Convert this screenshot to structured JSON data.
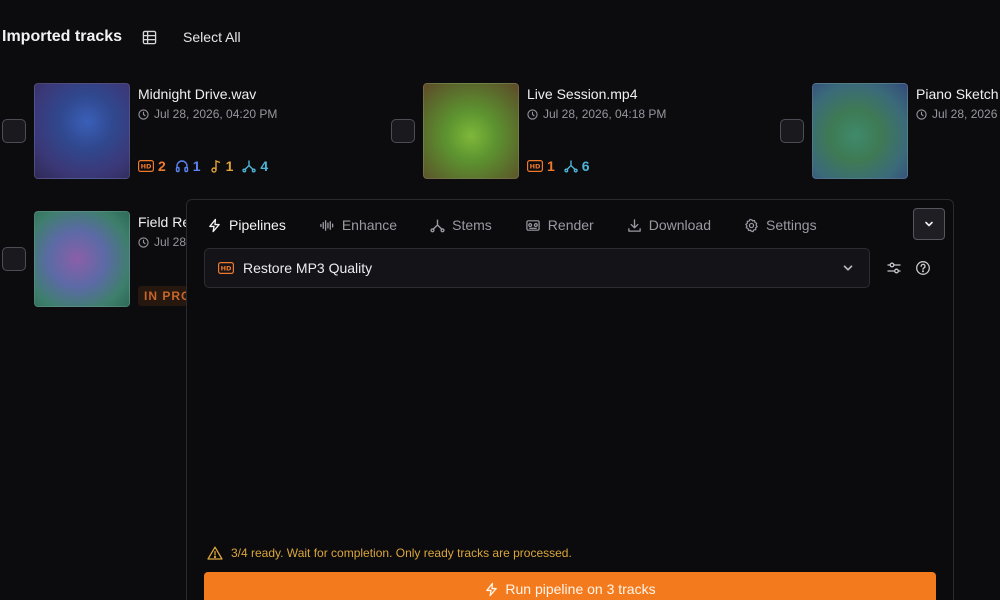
{
  "header": {
    "title": "Imported tracks",
    "select_all": "Select All"
  },
  "tracks": [
    {
      "name": "Midnight Drive.wav",
      "date": "Jul 28, 2026, 04:20 PM",
      "badges": {
        "hd": "2",
        "listen": "1",
        "music": "1",
        "stems": "4"
      }
    },
    {
      "name": "Live Session.mp4",
      "date": "Jul 28, 2026, 04:18 PM",
      "badges": {
        "hd": "1",
        "stems": "6"
      }
    },
    {
      "name": "Piano Sketch",
      "date": "Jul 28, 2026"
    },
    {
      "name": "Field Re",
      "date": "Jul 28",
      "status": "IN PRO"
    }
  ],
  "panel": {
    "tabs": [
      {
        "label": "Pipelines",
        "icon": "lightning-icon"
      },
      {
        "label": "Enhance",
        "icon": "waveform-icon"
      },
      {
        "label": "Stems",
        "icon": "stems-icon"
      },
      {
        "label": "Render",
        "icon": "render-icon"
      },
      {
        "label": "Download",
        "icon": "download-icon"
      },
      {
        "label": "Settings",
        "icon": "gear-icon"
      }
    ],
    "pipeline": {
      "selected": "Restore MP3 Quality",
      "icon": "hd-icon"
    },
    "warning": "3/4 ready. Wait for completion. Only ready tracks are processed.",
    "run_button": "Run pipeline on 3 tracks"
  },
  "colors": {
    "accent": "#f37b1e",
    "warning": "#d9a63c",
    "hd": "#f07a2b",
    "listen": "#5b84f0",
    "music": "#dea33a",
    "stems": "#4eb5d8"
  }
}
